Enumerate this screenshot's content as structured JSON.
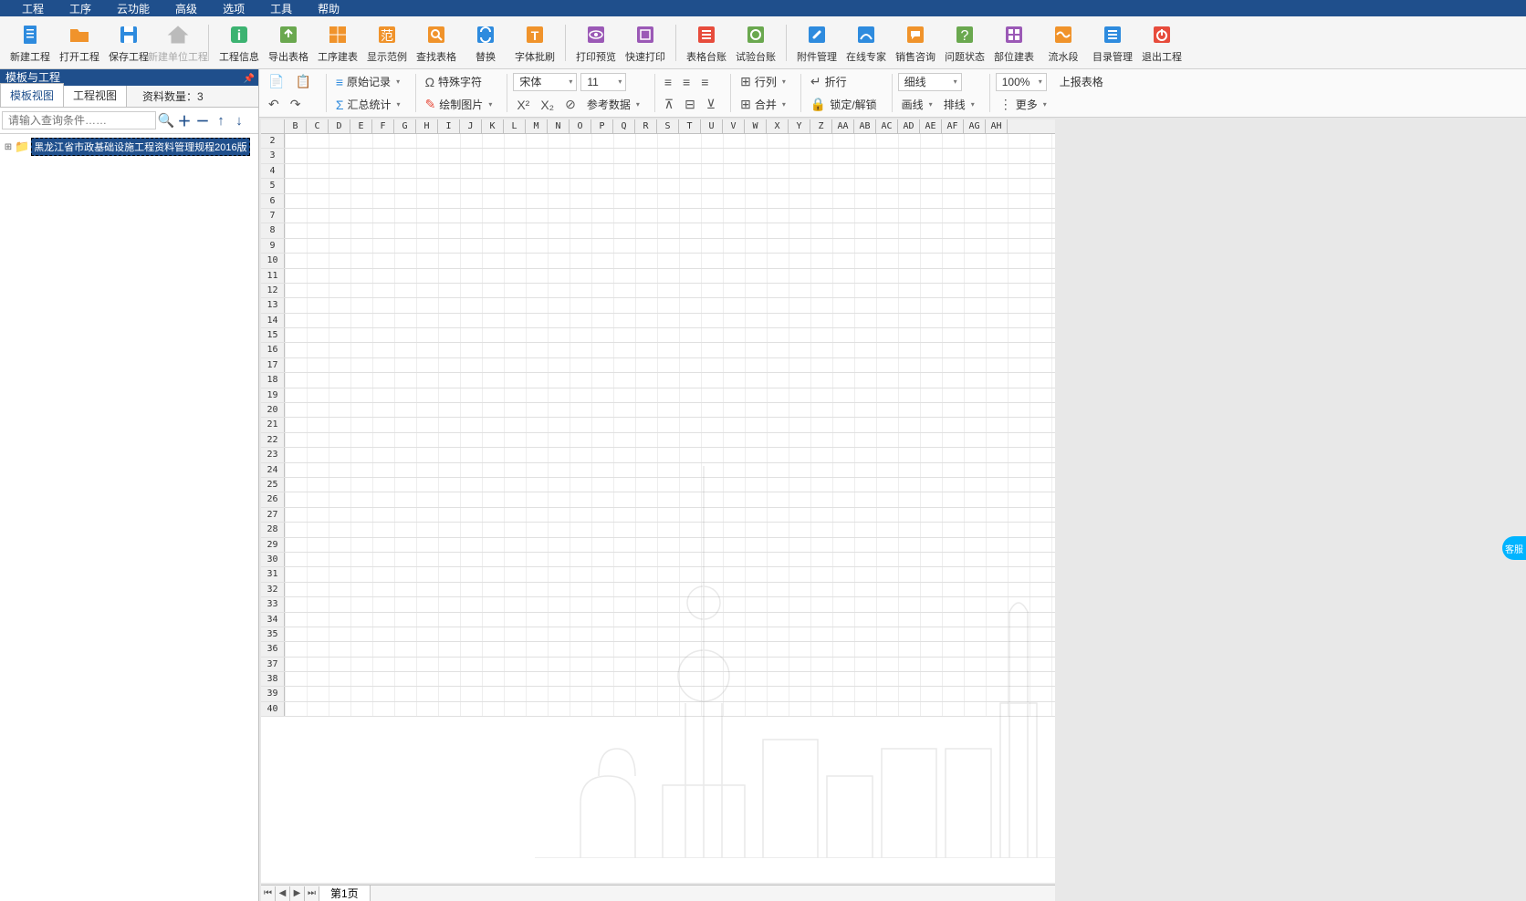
{
  "menu": {
    "items": [
      "工程",
      "工序",
      "云功能",
      "高级",
      "选项",
      "工具",
      "帮助"
    ]
  },
  "toolbar": {
    "groups": [
      [
        {
          "id": "new-project",
          "label": "新建工程",
          "color": "#2e8bde",
          "svg": "doc"
        },
        {
          "id": "open-project",
          "label": "打开工程",
          "color": "#f0932b",
          "svg": "folder"
        },
        {
          "id": "save-project",
          "label": "保存工程",
          "color": "#2e8bde",
          "svg": "save"
        },
        {
          "id": "new-unit-project",
          "label": "新建单位工程",
          "color": "#888",
          "svg": "home",
          "disabled": true
        }
      ],
      [
        {
          "id": "project-info",
          "label": "工程信息",
          "color": "#3cb371",
          "svg": "info"
        },
        {
          "id": "export-table",
          "label": "导出表格",
          "color": "#6aa84f",
          "svg": "export"
        },
        {
          "id": "build-table",
          "label": "工序建表",
          "color": "#f0932b",
          "svg": "grid"
        },
        {
          "id": "show-sample",
          "label": "显示范例",
          "color": "#f0932b",
          "svg": "fan"
        },
        {
          "id": "find-table",
          "label": "查找表格",
          "color": "#f0932b",
          "svg": "search"
        },
        {
          "id": "replace",
          "label": "替换",
          "color": "#2e8bde",
          "svg": "replace"
        },
        {
          "id": "font-brush",
          "label": "字体批刷",
          "color": "#f0932b",
          "svg": "brush"
        }
      ],
      [
        {
          "id": "print-preview",
          "label": "打印预览",
          "color": "#9b59b6",
          "svg": "eye"
        },
        {
          "id": "quick-print",
          "label": "快速打印",
          "color": "#9b59b6",
          "svg": "print"
        }
      ],
      [
        {
          "id": "table-ledger",
          "label": "表格台账",
          "color": "#e74c3c",
          "svg": "ledger"
        },
        {
          "id": "test-ledger",
          "label": "试验台账",
          "color": "#6aa84f",
          "svg": "test"
        }
      ],
      [
        {
          "id": "attach-mgr",
          "label": "附件管理",
          "color": "#2e8bde",
          "svg": "attach"
        },
        {
          "id": "online-expert",
          "label": "在线专家",
          "color": "#2e8bde",
          "svg": "expert"
        },
        {
          "id": "sales",
          "label": "销售咨询",
          "color": "#f0932b",
          "svg": "chat"
        },
        {
          "id": "issue-status",
          "label": "问题状态",
          "color": "#6aa84f",
          "svg": "status"
        },
        {
          "id": "unit-table",
          "label": "部位建表",
          "color": "#9b59b6",
          "svg": "unit"
        },
        {
          "id": "water-section",
          "label": "流水段",
          "color": "#f0932b",
          "svg": "water"
        },
        {
          "id": "dir-mgr",
          "label": "目录管理",
          "color": "#2e8bde",
          "svg": "list"
        },
        {
          "id": "exit-project",
          "label": "退出工程",
          "color": "#e74c3c",
          "svg": "power"
        }
      ]
    ]
  },
  "sidebar": {
    "title": "模板与工程",
    "tabs": [
      "模板视图",
      "工程视图"
    ],
    "active_tab": 0,
    "count_label": "资料数量：",
    "count_value": "3",
    "search_placeholder": "请输入查询条件……",
    "icons": [
      "search",
      "plus",
      "minus",
      "up",
      "down"
    ],
    "tree_item": "黑龙江省市政基础设施工程资料管理规程2016版"
  },
  "editor_toolbar": {
    "row1": {
      "copy": "",
      "paste": "",
      "orig_record": "原始记录",
      "special_char": "特殊字符",
      "font_sel": "宋体",
      "size_sel": "11",
      "row_btn": "行列",
      "wrap_btn": "折行",
      "border_sel": "细线",
      "zoom_sel": "100%",
      "report": "上报表格"
    },
    "row2": {
      "undo": "",
      "redo": "",
      "summary": "汇总统计",
      "draw_pic": "绘制图片",
      "ref_data": "参考数据",
      "merge": "合并",
      "lock": "锁定/解锁",
      "line": "画线",
      "sort": "排线",
      "more": "更多"
    }
  },
  "grid": {
    "cols": [
      "B",
      "C",
      "D",
      "E",
      "F",
      "G",
      "H",
      "I",
      "J",
      "K",
      "L",
      "M",
      "N",
      "O",
      "P",
      "Q",
      "R",
      "S",
      "T",
      "U",
      "V",
      "W",
      "X",
      "Y",
      "Z",
      "AA",
      "AB",
      "AC",
      "AD",
      "AE",
      "AF",
      "AG",
      "AH"
    ],
    "rows_start": 2,
    "rows_end": 40
  },
  "page_tab": "第1页",
  "service_label": "客服"
}
